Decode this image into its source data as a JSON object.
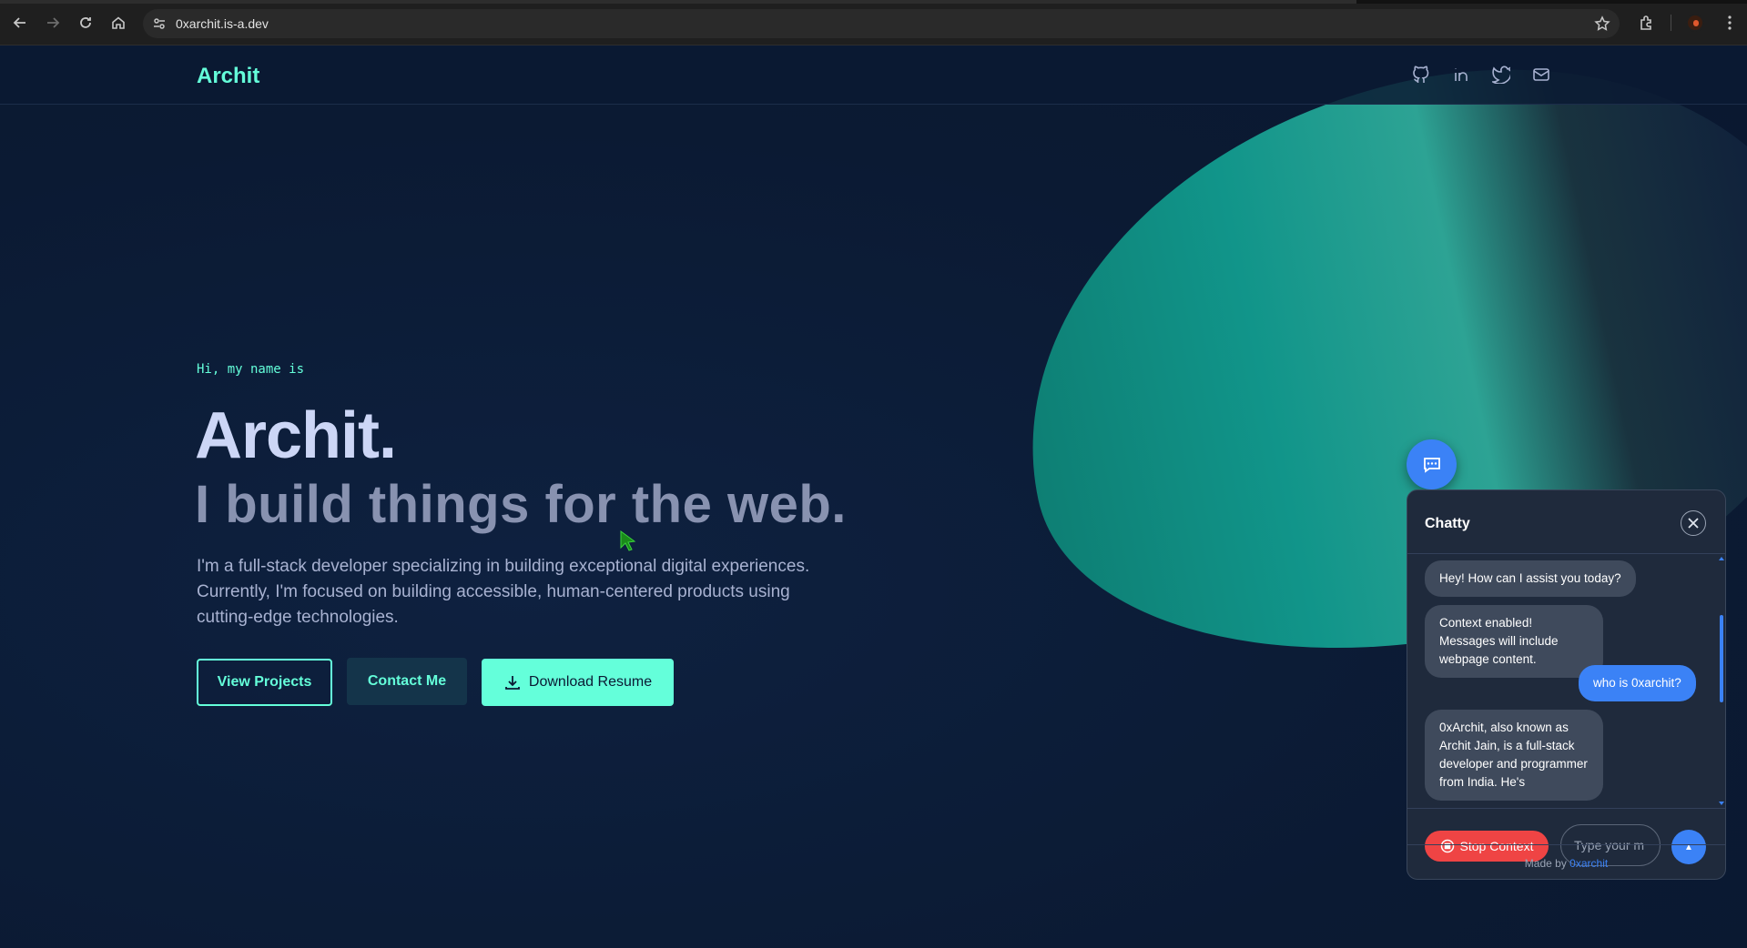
{
  "browser": {
    "url": "0xarchit.is-a.dev"
  },
  "header": {
    "logo": "Archit",
    "social": [
      "github-icon",
      "linkedin-icon",
      "twitter-icon",
      "mail-icon"
    ]
  },
  "hero": {
    "greeting": "Hi, my name is",
    "name": "Archit.",
    "tagline": "I build things for the web.",
    "description": "I'm a full-stack developer specializing in building exceptional digital experiences. Currently, I'm focused on building accessible, human-centered products using cutting-edge technologies.",
    "buttons": {
      "projects": "View Projects",
      "contact": "Contact Me",
      "resume": "Download Resume"
    }
  },
  "chat": {
    "title": "Chatty",
    "messages": [
      {
        "from": "bot",
        "text": "Hey! How can I assist you today?"
      },
      {
        "from": "bot",
        "text": "Context enabled! Messages will include webpage content."
      },
      {
        "from": "user",
        "text": "who is 0xarchit?"
      },
      {
        "from": "bot",
        "text": "0xArchit, also known as Archit Jain, is a full-stack developer and programmer from India. He's"
      }
    ],
    "stop_label": "Stop Context",
    "input_placeholder": "Type your m",
    "send_label": "▲",
    "footer_prefix": "Made by",
    "footer_brand": "0xarchit"
  },
  "colors": {
    "accent": "#64ffda",
    "background": "#0b1a33",
    "chat_blue": "#3b82f6",
    "stop_red": "#ef4444"
  }
}
